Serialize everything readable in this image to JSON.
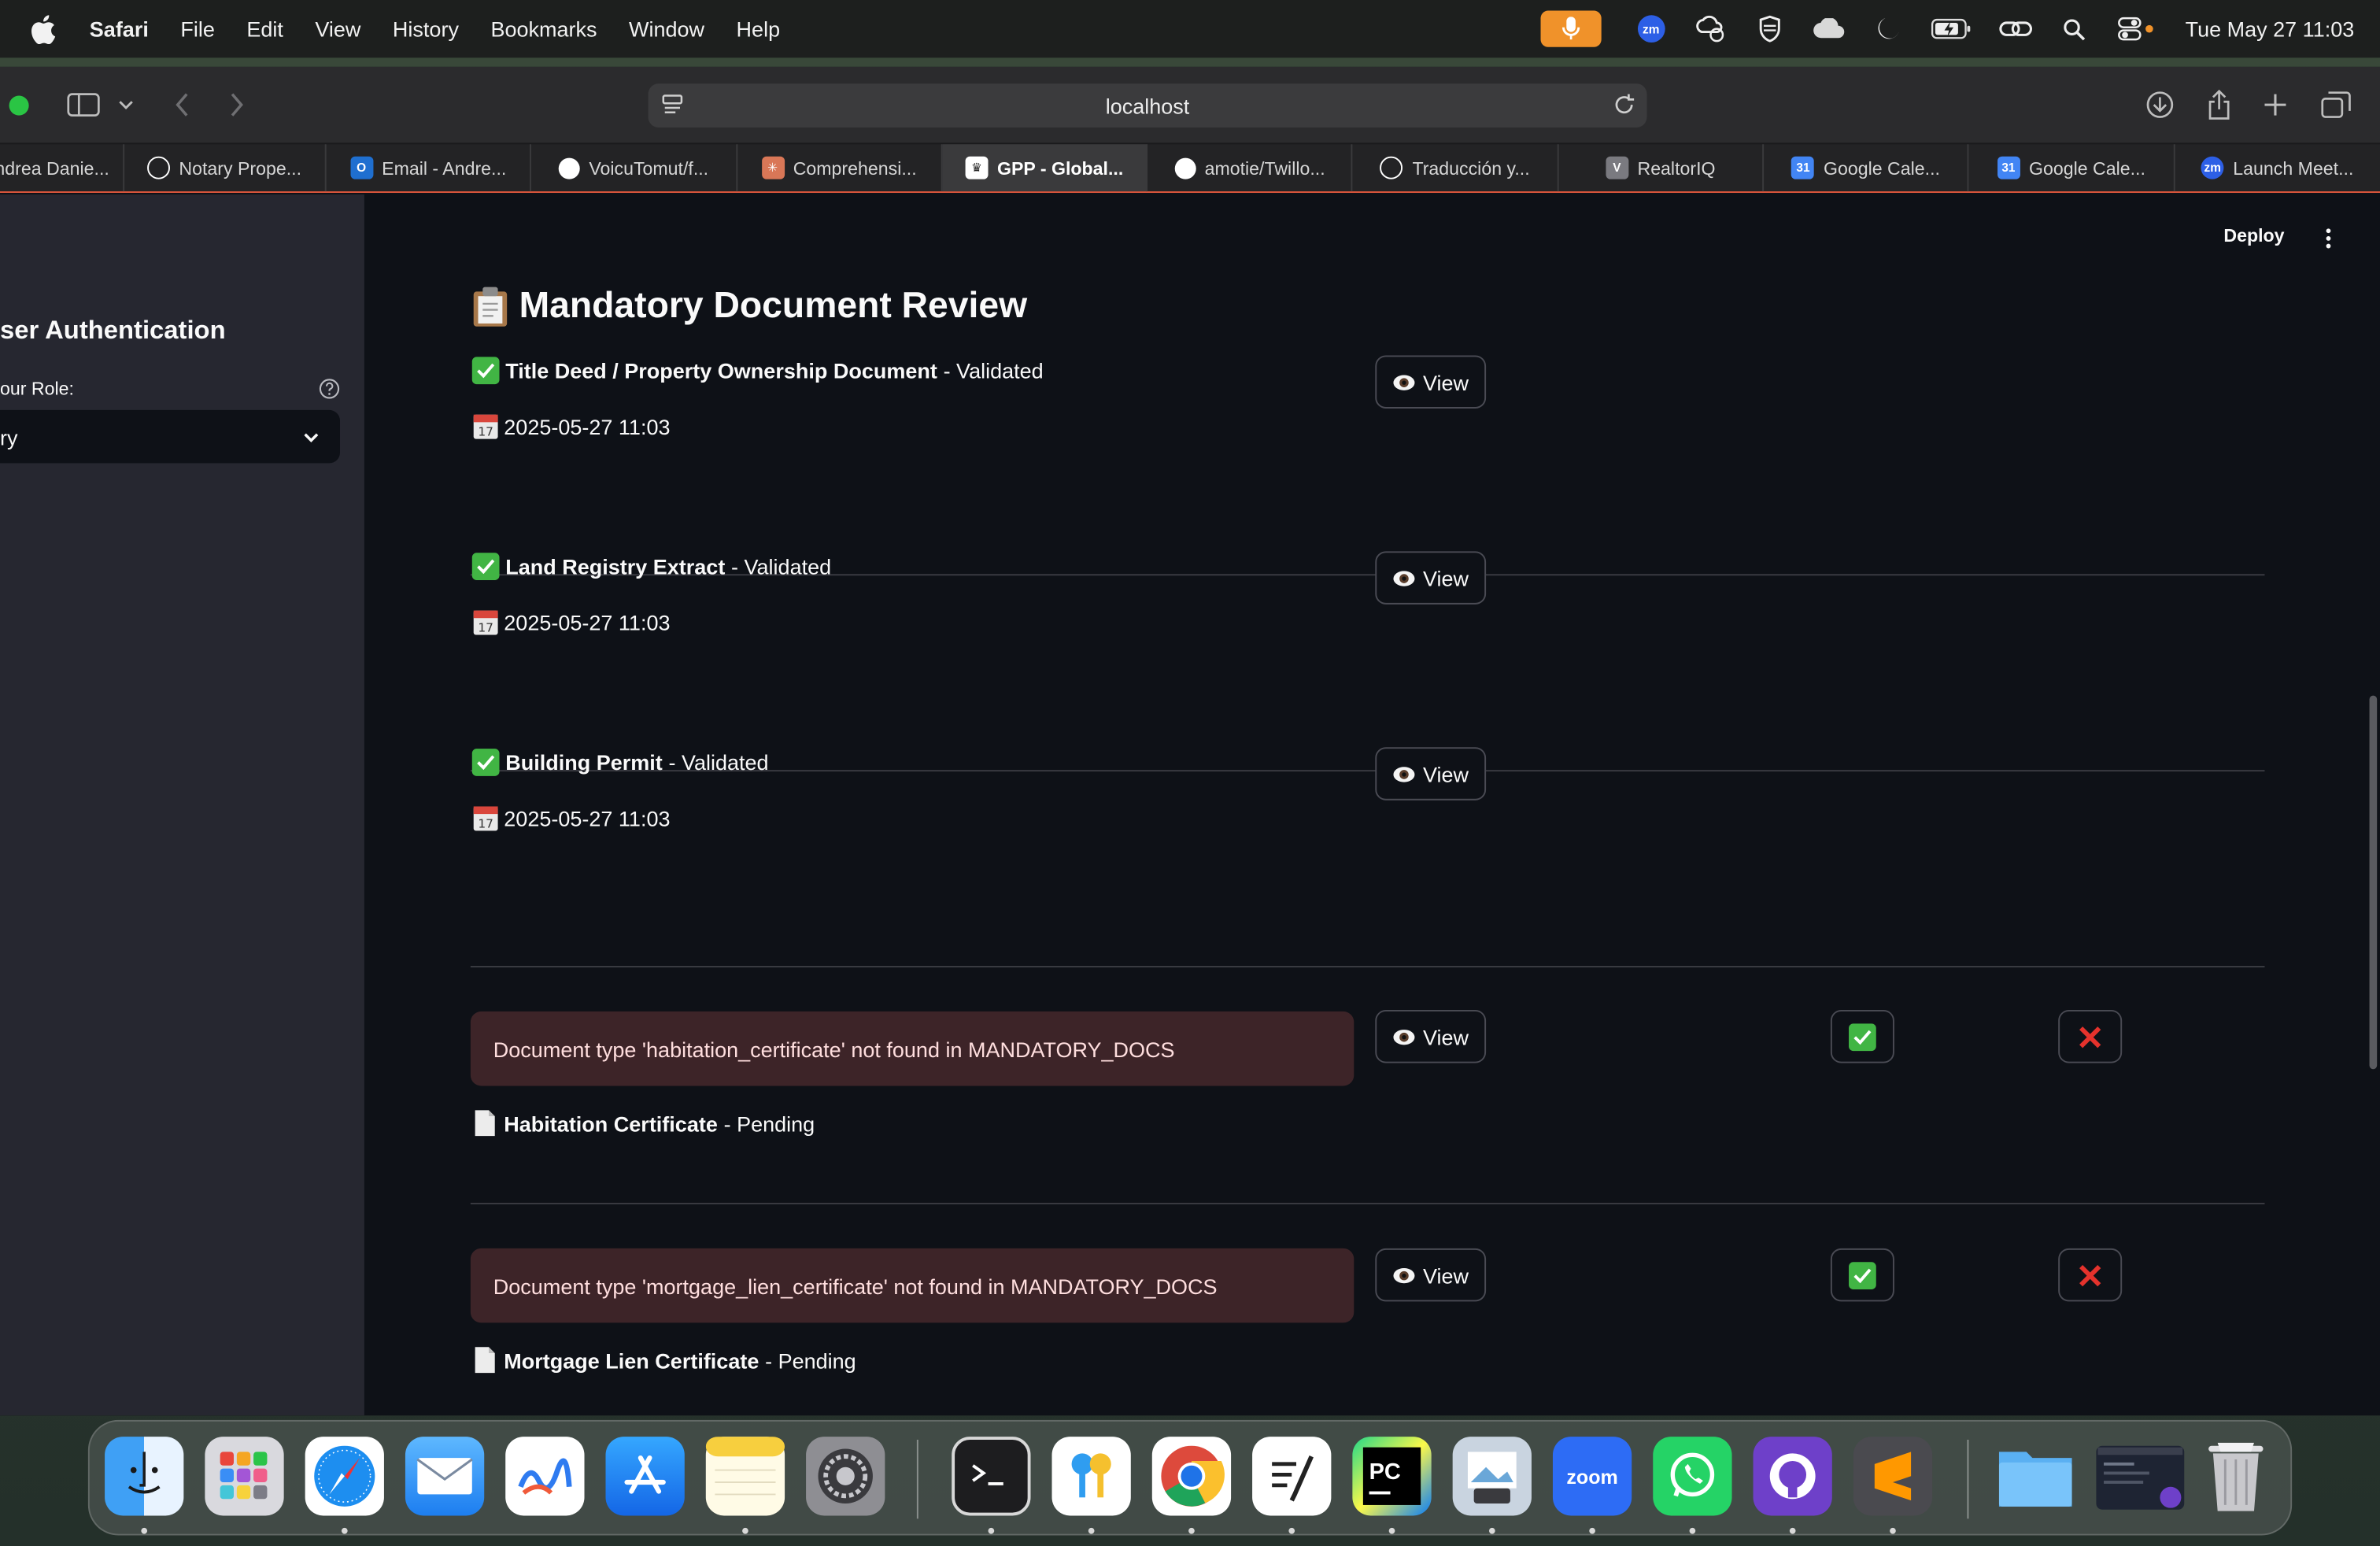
{
  "menubar": {
    "app_name": "Safari",
    "items": [
      "File",
      "Edit",
      "View",
      "History",
      "Bookmarks",
      "Window",
      "Help"
    ],
    "clock": "Tue May 27  11:03",
    "zoom_badge": "zm"
  },
  "browser": {
    "url": "localhost",
    "tabs": [
      {
        "label": "ndrea Danie...",
        "icon": "generic",
        "color": "#555"
      },
      {
        "label": "Notary Prope...",
        "icon": "openai",
        "color": "#ffffff"
      },
      {
        "label": "Email - Andre...",
        "icon": "outlook",
        "color": "#1f6fd0"
      },
      {
        "label": "VoicuTomut/f...",
        "icon": "github",
        "color": "#ffffff"
      },
      {
        "label": "Comprehensi...",
        "icon": "claude",
        "color": "#d97757"
      },
      {
        "label": "GPP - Global...",
        "icon": "crown",
        "color": "#ffffff"
      },
      {
        "label": "amotie/Twillo...",
        "icon": "github",
        "color": "#ffffff"
      },
      {
        "label": "Traducción y...",
        "icon": "openai",
        "color": "#ffffff"
      },
      {
        "label": "RealtorIQ",
        "icon": "v",
        "color": "#7a7a80"
      },
      {
        "label": "Google Cale...",
        "icon": "gcal",
        "color": "#4285f4"
      },
      {
        "label": "Google Cale...",
        "icon": "gcal",
        "color": "#4285f4"
      },
      {
        "label": "Launch Meet...",
        "icon": "zoom",
        "color": "#2d5fe6"
      }
    ]
  },
  "sidebar": {
    "title": "ser Authentication",
    "role_label": "our Role:",
    "role_value": "ry"
  },
  "header": {
    "deploy_label": "Deploy"
  },
  "main": {
    "title": "Mandatory Document Review",
    "view_label": "View",
    "validated_docs": [
      {
        "name": "Title Deed / Property Ownership Document",
        "status": "- Validated",
        "date": "2025-05-27 11:03"
      },
      {
        "name": "Land Registry Extract",
        "status": "- Validated",
        "date": "2025-05-27 11:03"
      },
      {
        "name": "Building Permit",
        "status": "- Validated",
        "date": "2025-05-27 11:03"
      }
    ],
    "pending_docs": [
      {
        "error": "Document type 'habitation_certificate' not found in MANDATORY_DOCS",
        "name": "Habitation Certificate",
        "status": "- Pending"
      },
      {
        "error": "Document type 'mortgage_lien_certificate' not found in MANDATORY_DOCS",
        "name": "Mortgage Lien Certificate",
        "status": "- Pending"
      }
    ]
  },
  "dock": {
    "apps": [
      "finder",
      "launchpad",
      "safari",
      "mail",
      "freeform",
      "app-store",
      "notes",
      "system-settings",
      "terminal",
      "passwords",
      "chrome",
      "ia-writer",
      "pycharm",
      "preview",
      "zoom",
      "whatsapp",
      "github-desktop",
      "sublime-text",
      "downloads-folder",
      "window-thumbnail",
      "trash"
    ],
    "zoom_label": "zoom",
    "pycharm_label": "PC"
  }
}
